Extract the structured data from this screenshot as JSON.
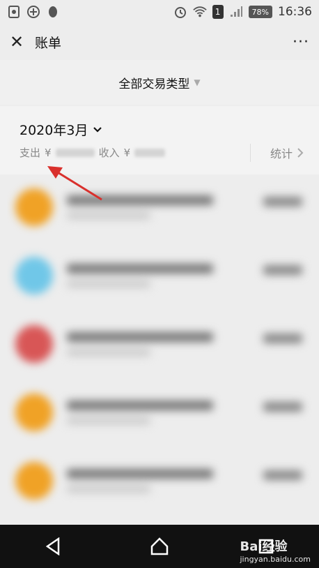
{
  "status_bar": {
    "left_icons": [
      "notification-icon",
      "add-circle-icon",
      "qq-icon"
    ],
    "sim_label": "1",
    "battery": "78%",
    "time": "16:36"
  },
  "title_bar": {
    "close_glyph": "✕",
    "title": "账单",
    "more_glyph": "···"
  },
  "filter": {
    "label": "全部交易类型"
  },
  "month_block": {
    "month_label": "2020年3月",
    "expense_label": "支出",
    "currency": "¥",
    "income_label": "收入",
    "stats_label": "统计"
  },
  "transactions": [
    {
      "avatar_color": "#f0a226"
    },
    {
      "avatar_color": "#70c7e8"
    },
    {
      "avatar_color": "#d85656"
    },
    {
      "avatar_color": "#f0a226"
    },
    {
      "avatar_color": "#f0a226"
    }
  ],
  "watermark": {
    "brand": "Bai",
    "product": "经验",
    "url": "jingyan.baidu.com"
  },
  "colors": {
    "background": "#ededed",
    "arrow": "#d9302c",
    "navbar": "#111111"
  }
}
